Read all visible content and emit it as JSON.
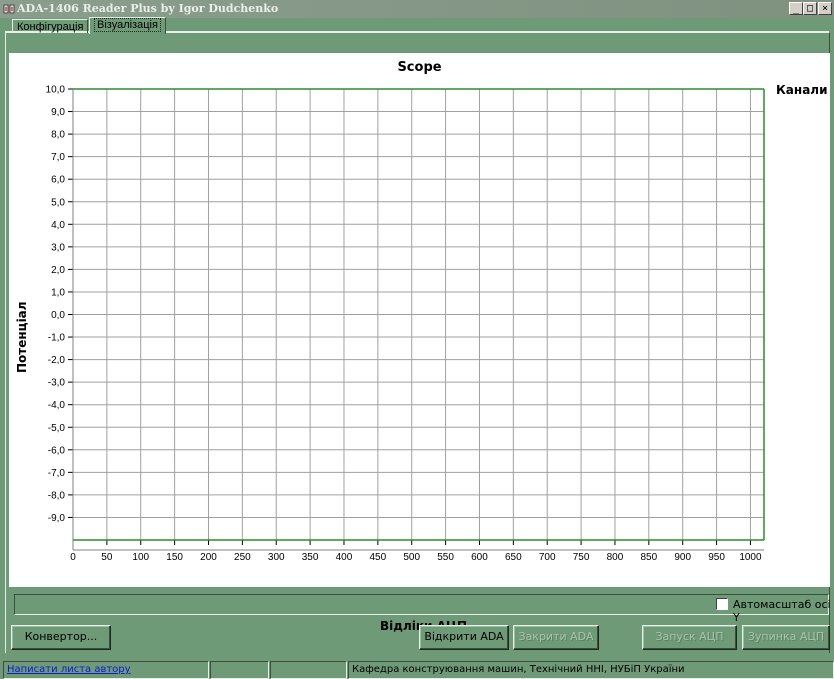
{
  "window": {
    "title": "ADA-1406 Reader Plus by Igor Dudchenko",
    "icon": "app-icon",
    "controls": [
      "minimize-icon",
      "maximize-icon",
      "close-icon"
    ]
  },
  "tabs": [
    {
      "label": "Конфігурація",
      "active": false
    },
    {
      "label": "Візуалізація",
      "active": true
    }
  ],
  "chart": {
    "legend_title": "Канали"
  },
  "chart_data": {
    "type": "line",
    "title": "Scope",
    "xlabel": "Відліки АЦП",
    "ylabel": "Потенціал",
    "xlim": [
      0,
      1020
    ],
    "ylim": [
      -10,
      10
    ],
    "x_ticks": [
      "0",
      "50",
      "100",
      "150",
      "200",
      "250",
      "300",
      "350",
      "400",
      "450",
      "500",
      "550",
      "600",
      "650",
      "700",
      "750",
      "800",
      "850",
      "900",
      "950",
      "1000"
    ],
    "y_ticks": [
      "10,0",
      "9,0",
      "8,0",
      "7,0",
      "6,0",
      "5,0",
      "4,0",
      "3,0",
      "2,0",
      "1,0",
      "0,0",
      "-1,0",
      "-2,0",
      "-3,0",
      "-4,0",
      "-5,0",
      "-6,0",
      "-7,0",
      "-8,0",
      "-9,0"
    ],
    "grid": true,
    "series": [],
    "colors": {
      "grid": "#a0a0a0",
      "frame": "#2e8b2e",
      "axis": "#808080"
    }
  },
  "options": {
    "autoscale_label": "Автомасштаб осі Y",
    "autoscale_checked": false
  },
  "buttons": {
    "converter": "Конвертор...",
    "open_ada": "Відкрити ADA",
    "close_ada": "Закрити ADA",
    "start_adc": "Запуск АЦП",
    "stop_adc": "Зупинка АЦП"
  },
  "statusbar": {
    "link": "Написати листа автору",
    "info": "Кафедра конструювання машин, Технічний ННІ, НУБіП України"
  },
  "theme": {
    "window_bg": "#6f9a78",
    "highlight": "#e7eee6"
  }
}
